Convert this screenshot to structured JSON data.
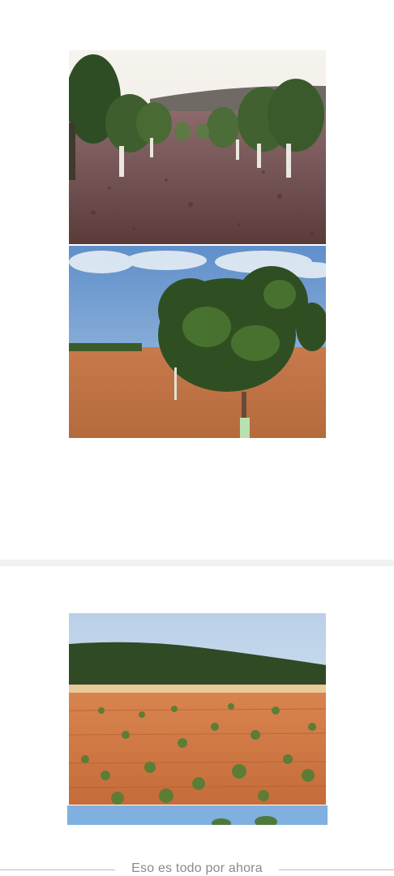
{
  "feed": {
    "photos": [
      {
        "description_id": "pistachio-orchard-gray-soil"
      },
      {
        "description_id": "pistachio-tree-red-soil"
      },
      {
        "description_id": "young-orchard-hillside"
      },
      {
        "description_id": "partial-next-photo"
      }
    ]
  },
  "footer": {
    "end_message": "Eso es todo por ahora"
  },
  "colors": {
    "background": "#ffffff",
    "divider": "#f1f1f1",
    "end_text": "#8a8a8a",
    "end_line": "#bdbdbd"
  }
}
